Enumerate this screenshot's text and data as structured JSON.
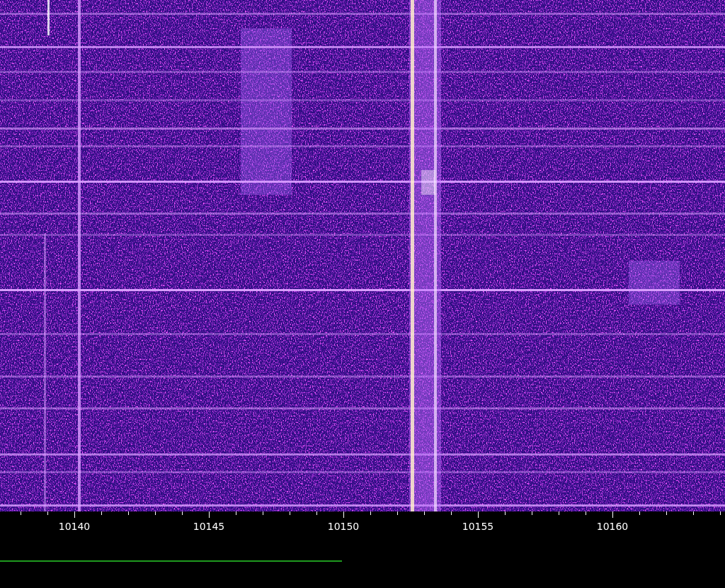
{
  "frequency_axis": {
    "labels": [
      "10140",
      "10145",
      "10150",
      "10155",
      "10160"
    ]
  },
  "level_bar": {
    "level": 0.472
  }
}
